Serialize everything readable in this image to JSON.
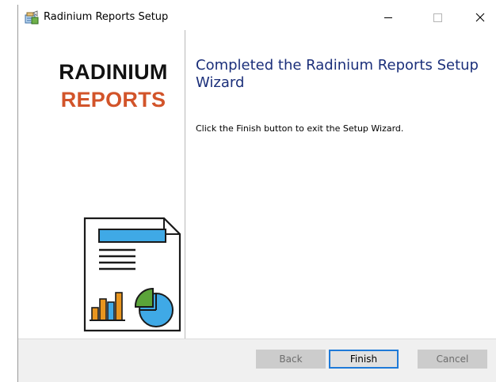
{
  "window": {
    "title": "Radinium Reports Setup",
    "icon": "installer-package-icon",
    "controls": [
      "minimize",
      "maximize",
      "close"
    ]
  },
  "sidebar": {
    "brand_line1": "RADINIUM",
    "brand_line2": "REPORTS",
    "brand_colors": {
      "line1": "#111111",
      "line2": "#d2542a"
    },
    "illustration": "report-document-icon"
  },
  "main": {
    "heading": "Completed the Radinium Reports Setup Wizard",
    "message": "Click the Finish button to exit the Setup Wizard."
  },
  "footer": {
    "back_label": "Back",
    "finish_label": "Finish",
    "cancel_label": "Cancel"
  },
  "colors": {
    "accent": "#1e7ad8",
    "heading": "#1b2f7a"
  }
}
